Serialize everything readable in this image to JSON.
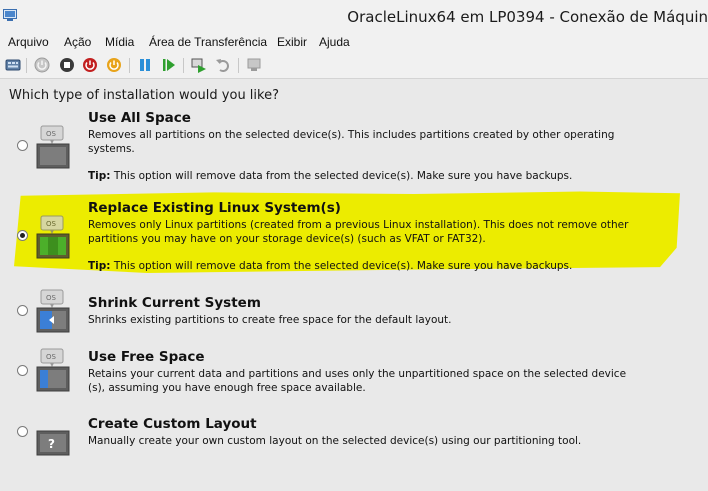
{
  "window": {
    "title": "OracleLinux64 em LP0394 - Conexão de Máquin"
  },
  "menu": [
    "Arquivo",
    "Ação",
    "Mídia",
    "Área de Transferência",
    "Exibir",
    "Ajuda"
  ],
  "toolbar_icons": [
    "ctrl-alt-del-icon",
    "start-icon",
    "turn-off-icon",
    "shutdown-icon",
    "power-icon",
    "pause-icon",
    "resume-icon",
    "checkpoint-icon",
    "revert-icon",
    "enhanced-session-icon"
  ],
  "question": "Which type of installation would you like?",
  "tip_label": "Tip:",
  "options": [
    {
      "title": "Use All Space",
      "desc": [
        "Removes all partitions on the selected device(s).  This includes partitions created by other operating",
        "systems."
      ],
      "tip": "This option will remove data from the selected device(s).  Make sure you have backups.",
      "selected": false,
      "highlighted": false
    },
    {
      "title": "Replace Existing Linux System(s)",
      "desc": [
        "Removes only Linux partitions (created from a previous Linux installation).  This does not remove other",
        "partitions you may have on your storage device(s) (such as VFAT or FAT32)."
      ],
      "tip": "This option will remove data from the selected device(s).  Make sure you have backups.",
      "selected": true,
      "highlighted": true
    },
    {
      "title": "Shrink Current System",
      "desc": [
        "Shrinks existing partitions to create free space for the default layout."
      ],
      "selected": false,
      "highlighted": false
    },
    {
      "title": "Use Free Space",
      "desc": [
        "Retains your current data and partitions and uses only the unpartitioned space on the selected device",
        "(s), assuming you have enough free space available."
      ],
      "selected": false,
      "highlighted": false
    },
    {
      "title": "Create Custom Layout",
      "desc": [
        "Manually create your own custom layout on the selected device(s) using our partitioning tool."
      ],
      "selected": false,
      "highlighted": false
    }
  ],
  "colors": {
    "highlight": "#ecec00",
    "background": "#e9e9e9",
    "accent_blue": "#3b7fd6",
    "accent_green": "#4caf2a"
  }
}
